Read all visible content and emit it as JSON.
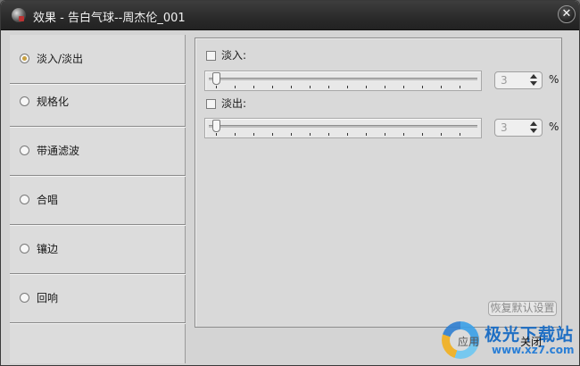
{
  "window": {
    "title": "效果 - 告白气球--周杰伦_001",
    "close_glyph": "✕"
  },
  "sidebar": {
    "items": [
      {
        "label": "淡入/淡出",
        "selected": true
      },
      {
        "label": "规格化",
        "selected": false
      },
      {
        "label": "带通滤波",
        "selected": false
      },
      {
        "label": "合唱",
        "selected": false
      },
      {
        "label": "镶边",
        "selected": false
      },
      {
        "label": "回响",
        "selected": false
      }
    ]
  },
  "panel": {
    "fade_in": {
      "label": "淡入:",
      "checked": false,
      "value": "3",
      "unit": "%"
    },
    "fade_out": {
      "label": "淡出:",
      "checked": false,
      "value": "3",
      "unit": "%"
    },
    "restore_label": "恢复默认设置"
  },
  "footer": {
    "apply_label": "应用",
    "close_label": "关闭"
  },
  "watermark": {
    "name": "极光下载站",
    "url": "www.xz7.com"
  }
}
